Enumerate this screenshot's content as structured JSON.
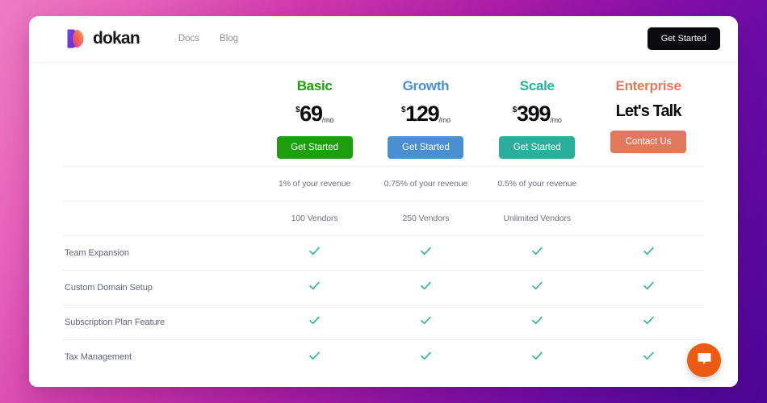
{
  "header": {
    "brand_name": "dokan",
    "brand_logo_icon": "dokan-logo-icon",
    "nav": [
      {
        "label": "Docs"
      },
      {
        "label": "Blog"
      }
    ],
    "cta_label": "Get Started"
  },
  "colors": {
    "background_gradient_start": "#ee7bc4",
    "background_gradient_end": "#4c0596",
    "basic": "#1c9e0d",
    "growth": "#4a90d0",
    "scale": "#2bae9c",
    "enterprise": "#e2785e",
    "enterprise_button": "#e2785e",
    "check": "#2bae9c",
    "header_cta": "#0b0b0f",
    "chat_widget": "#ec5b11",
    "divider": "#ededf1"
  },
  "pricing": {
    "plans": [
      {
        "name": "Basic",
        "currency": "$",
        "amount": "69",
        "period": "/mo",
        "price_text": null,
        "cta_label": "Get Started",
        "accent": "#1c9e0d",
        "revenue_note": "1% of your revenue",
        "vendor_note": "100 Vendors"
      },
      {
        "name": "Growth",
        "currency": "$",
        "amount": "129",
        "period": "/mo",
        "price_text": null,
        "cta_label": "Get Started",
        "accent": "#4a90d0",
        "revenue_note": "0.75% of your revenue",
        "vendor_note": "250 Vendors"
      },
      {
        "name": "Scale",
        "currency": "$",
        "amount": "399",
        "period": "/mo",
        "price_text": null,
        "cta_label": "Get Started",
        "accent": "#2bae9c",
        "revenue_note": "0.5% of your revenue",
        "vendor_note": "Unlimited Vendors"
      },
      {
        "name": "Enterprise",
        "currency": null,
        "amount": null,
        "period": null,
        "price_text": "Let's Talk",
        "cta_label": "Contact Us",
        "accent": "#e2785e",
        "revenue_note": "",
        "vendor_note": ""
      }
    ],
    "features": [
      {
        "label": "Team Expansion",
        "values": [
          true,
          true,
          true,
          true
        ]
      },
      {
        "label": "Custom Domain Setup",
        "values": [
          true,
          true,
          true,
          true
        ]
      },
      {
        "label": "Subscription Plan Feature",
        "values": [
          true,
          true,
          true,
          true
        ]
      },
      {
        "label": "Tax Management",
        "values": [
          true,
          true,
          true,
          true
        ]
      }
    ],
    "check_icon": "check-icon"
  },
  "chat": {
    "icon": "chat-bubble-icon",
    "label": "Open chat"
  }
}
